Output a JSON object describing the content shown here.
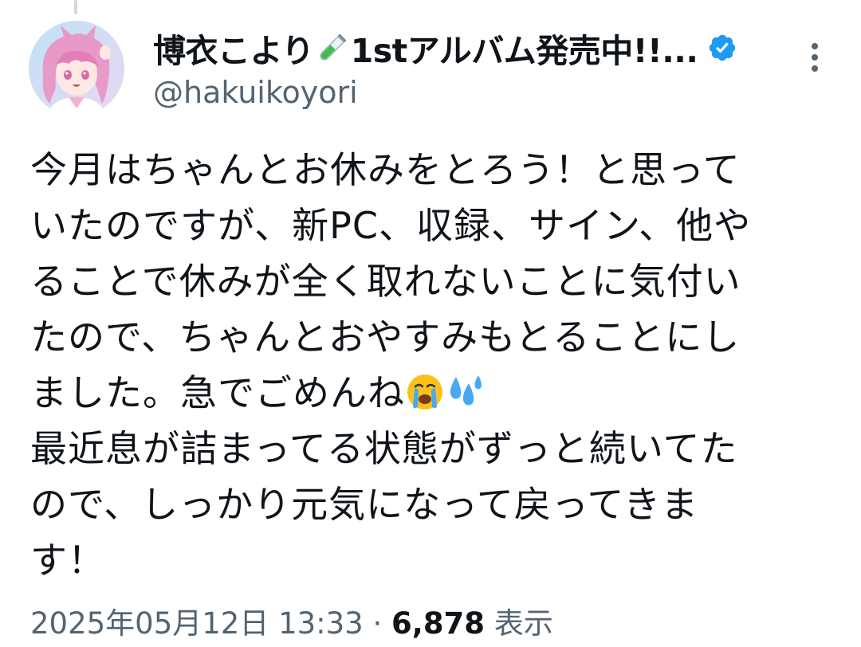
{
  "author": {
    "display_name": "博衣こより",
    "name_suffix": "1stアルバム発売中!!...",
    "handle": "@hakuikoyori",
    "verified": true,
    "name_emoji": "test-tube-icon"
  },
  "tweet": {
    "lines": [
      "今月はちゃんとお休みをとろう！と思って",
      "いたのですが、新PC、収録、サイン、他や",
      "ることで休みが全く取れないことに気付い",
      "たので、ちゃんとおやすみもとることにし",
      "ました。急でごめんね",
      "最近息が詰まってる状態がずっと続いてた",
      "ので、しっかり元気になって戻ってきま",
      "す！"
    ],
    "emoji_after_line_5": [
      "crying-face-icon",
      "sweat-droplets-icon"
    ],
    "timestamp": "2025年05月12日 13:33",
    "separator": "·",
    "views_count": "6,878",
    "views_label": "表示"
  },
  "colors": {
    "text": "#0f1419",
    "secondary": "#536471",
    "verified": "#1d9bf0",
    "thread_line": "#cfd9de"
  }
}
